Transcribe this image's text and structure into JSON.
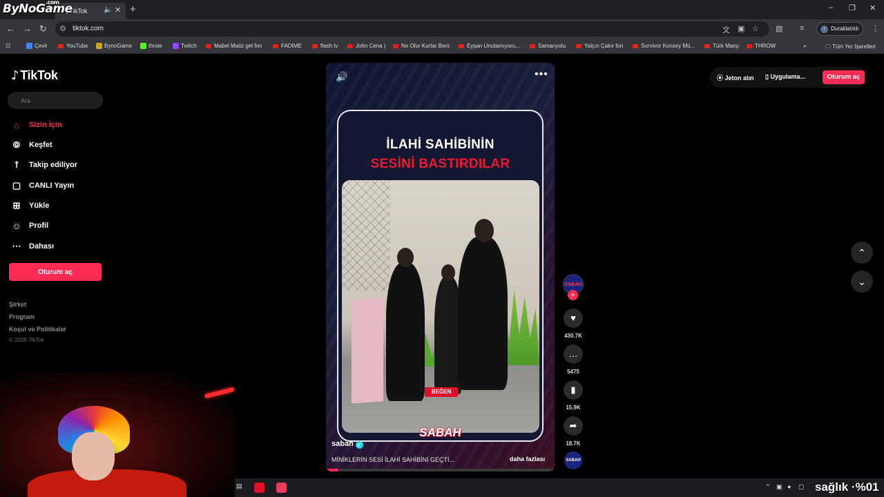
{
  "overlay": {
    "watermark": "ByNoGame",
    "watermark_domain": ".com",
    "tray_overlay": "sağlık ·%01"
  },
  "browser": {
    "tab_title": "| TikTok",
    "url": "tiktok.com",
    "profile": "Duraklatıldı",
    "profile_initial": "I",
    "bookmarks": [
      "Çevir",
      "YouTube",
      "BynoGame",
      "throw",
      "Twitch",
      "Mabel Matiz gel fon",
      "FADIME",
      "flash tv",
      "John Cena )",
      "Ne Olur Kurtar Beni",
      "Eyşan Unutamıyoru...",
      "Samanyolu",
      "Yalçın Çakır fon",
      "Survivor Konsey Mü...",
      "Türk Marşı",
      "THROW"
    ],
    "all_bookmarks": "Tüm Yer İşaretleri"
  },
  "tiktok": {
    "logo": "TikTok",
    "search_placeholder": "Ara",
    "nav": [
      "Sizin İçin",
      "Keşfet",
      "Takip ediliyor",
      "CANLI Yayın",
      "Yükle",
      "Profil",
      "Dahası"
    ],
    "login": "Oturum aç",
    "footer": [
      "Şirket",
      "Program",
      "Koşul ve Politikalar"
    ],
    "copyright": "© 2026 TikTok",
    "top_right": {
      "coins": "Jeton alın",
      "app": "Uygulama...",
      "login": "Oturum aç"
    }
  },
  "video": {
    "headline_line1": "İLAHİ SAHİBİNİN",
    "headline_line2": "SESİNİ BASTIRDILAR",
    "like_sticker": "BEĞEN",
    "brand": "SABAH",
    "author": "sabah",
    "caption": "MİNİKLERİN SESİ İLAHİ SAHİBİNİ GEÇTİ...",
    "more": "daha fazlası",
    "progress": 0.05,
    "avatar_label": "SABAH",
    "likes": "430.7K",
    "comments": "5475",
    "saves": "15.9K",
    "shares": "18.7K"
  },
  "colors": {
    "accent": "#fe2c55",
    "headline_red": "#f0182e",
    "background": "#000000"
  },
  "icons": [
    "home-icon",
    "compass-icon",
    "following-icon",
    "live-icon",
    "upload-icon",
    "profile-icon",
    "more-icon",
    "heart-icon",
    "comment-icon",
    "bookmark-icon",
    "share-icon",
    "chevron-up-icon",
    "chevron-down-icon"
  ]
}
